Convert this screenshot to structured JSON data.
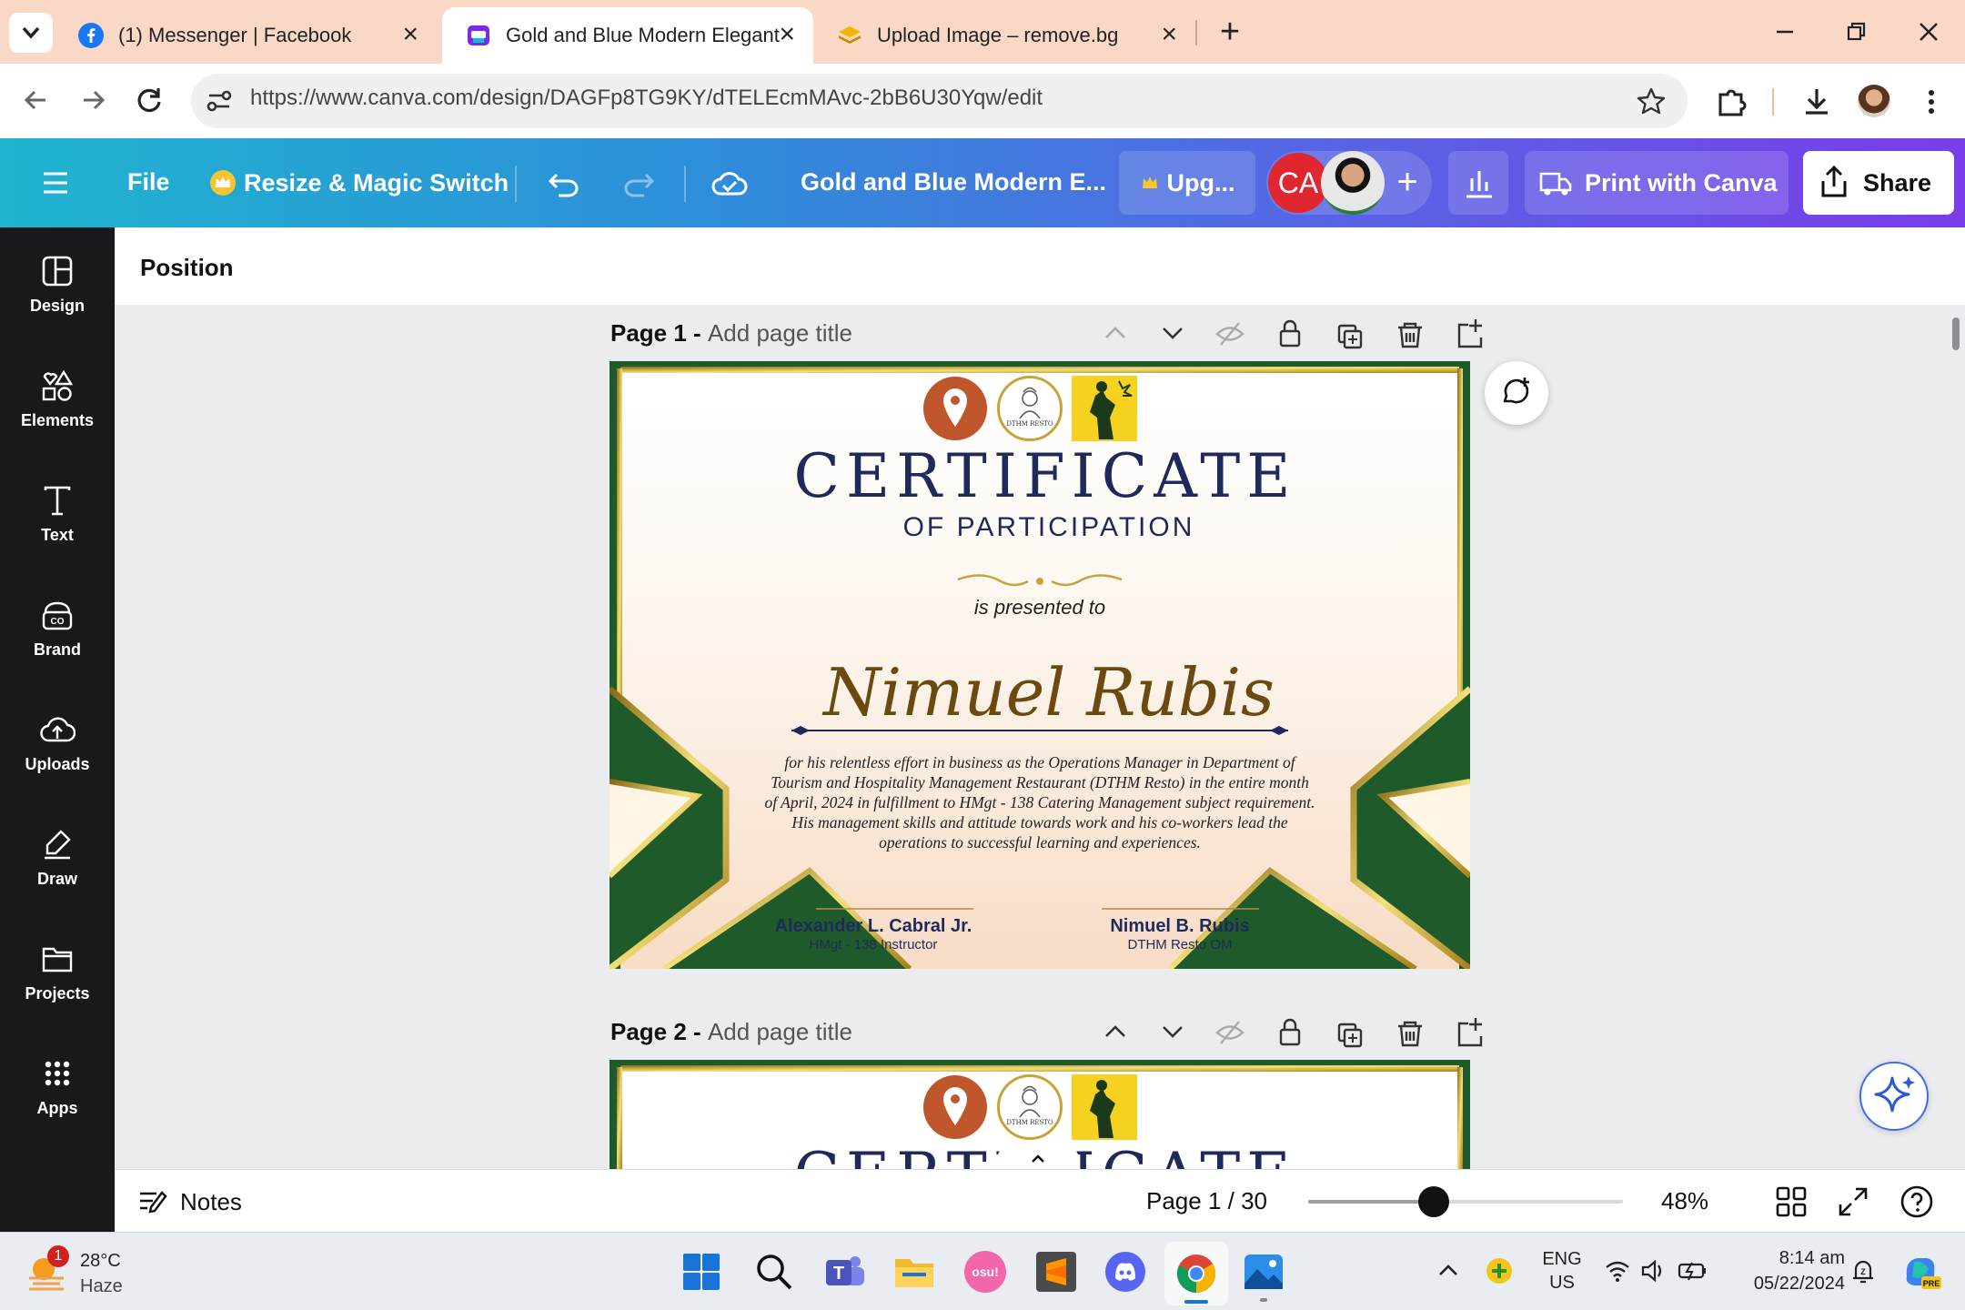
{
  "browser": {
    "tabs": [
      {
        "title": "(1) Messenger | Facebook",
        "icon": "facebook-icon"
      },
      {
        "title": "Gold and Blue Modern Elegant",
        "icon": "canva-icon",
        "active": true
      },
      {
        "title": "Upload Image – remove.bg",
        "icon": "removebg-icon"
      }
    ],
    "url": "https://www.canva.com/design/DAGFp8TG9KY/dTELEcmMAvc-2bB6U30Yqw/edit"
  },
  "header": {
    "file": "File",
    "resize": "Resize & Magic Switch",
    "doc_title": "Gold and Blue Modern E...",
    "upgrade": "Upg...",
    "avatar_initials": "CA",
    "print": "Print with Canva",
    "share": "Share"
  },
  "sidebar": {
    "items": [
      {
        "label": "Design",
        "icon": "design-icon"
      },
      {
        "label": "Elements",
        "icon": "elements-icon"
      },
      {
        "label": "Text",
        "icon": "text-icon"
      },
      {
        "label": "Brand",
        "icon": "brand-icon"
      },
      {
        "label": "Uploads",
        "icon": "uploads-icon"
      },
      {
        "label": "Draw",
        "icon": "draw-icon"
      },
      {
        "label": "Projects",
        "icon": "projects-icon"
      },
      {
        "label": "Apps",
        "icon": "apps-icon"
      }
    ]
  },
  "toolbar": {
    "position": "Position"
  },
  "pages": [
    {
      "label": "Page 1 -",
      "placeholder": "Add page title"
    },
    {
      "label": "Page 2 -",
      "placeholder": "Add page title"
    }
  ],
  "certificate": {
    "logo_text": "DTHM RESTO",
    "title": "CERTIFICATE",
    "subtitle": "OF PARTICIPATION",
    "presented": "is presented to",
    "name": "Nimuel Rubis",
    "body": [
      "for his relentless effort in business as the Operations Manager in Department of",
      "Tourism and Hospitality Management Restaurant (DTHM Resto) in the entire month",
      "of April, 2024 in fulfillment to HMgt - 138 Catering Management subject requirement.",
      "His management skills and attitude towards work and his co-workers lead the",
      "operations to successful learning and experiences."
    ],
    "signatories": [
      {
        "name": "Alexander L. Cabral Jr.",
        "role": "HMgt - 138 Instructor"
      },
      {
        "name": "Nimuel B. Rubis",
        "role": "DTHM Resto OM"
      }
    ]
  },
  "bottom": {
    "notes": "Notes",
    "page_indicator": "Page 1 / 30",
    "zoom": "48%",
    "zoom_fraction": 0.4
  },
  "taskbar": {
    "weather_temp": "28°C",
    "weather_desc": "Haze",
    "weather_badge": "1",
    "lang_top": "ENG",
    "lang_bottom": "US",
    "time": "8:14 am",
    "date": "05/22/2024",
    "osu_label": "osu!"
  },
  "colors": {
    "canva_gradient_start": "#1fb4cf",
    "canva_gradient_end": "#7a3de8",
    "cert_navy": "#1f2a5c",
    "cert_green": "#1e5a2a",
    "cert_gold": "#b8860b",
    "name_brown": "#6b4a10"
  }
}
